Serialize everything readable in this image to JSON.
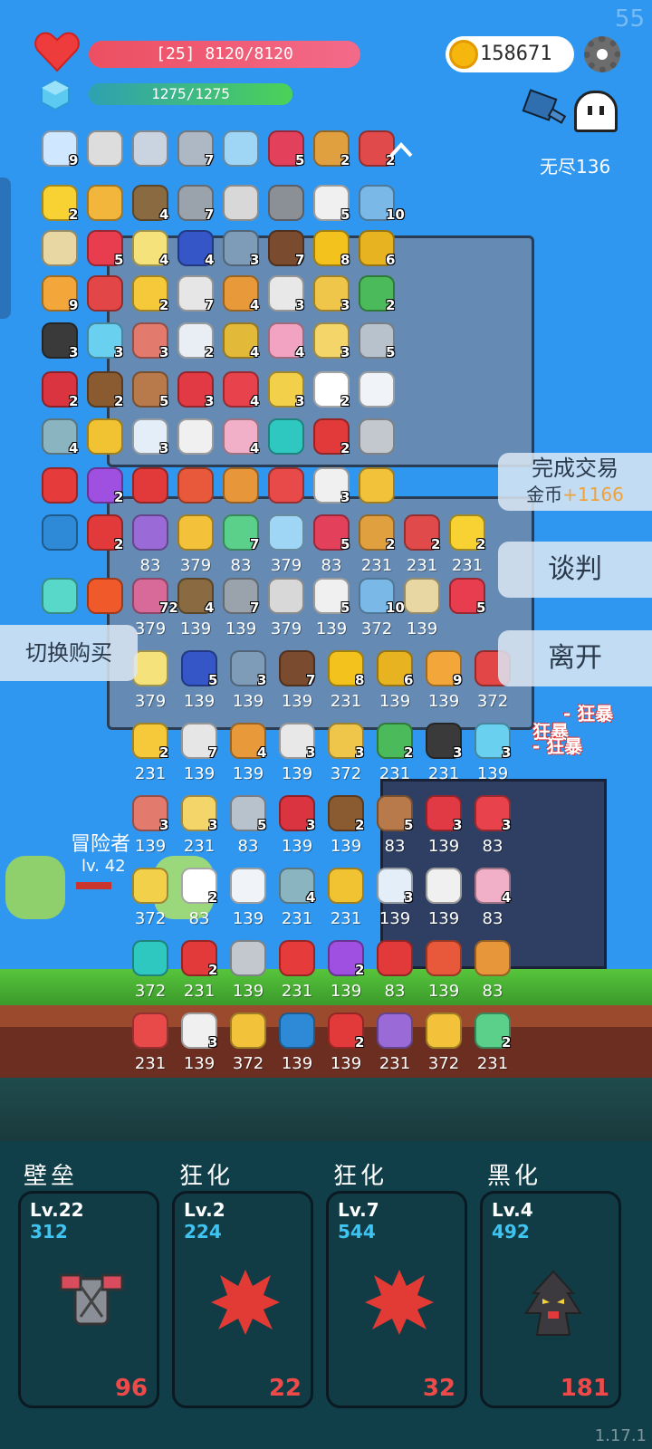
{
  "system": {
    "fps": "55",
    "version": "1.17.1"
  },
  "status": {
    "hp_text": "[25] 8120/8120",
    "hp_fraction": 1.0,
    "mp_text": "1275/1275",
    "mp_fraction": 1.0,
    "gold": "158671",
    "mode_label": "无尽136"
  },
  "colors": {
    "sky": "#2f97f0",
    "hp": "#ec4f61",
    "mp": "#4cd257",
    "gold_accent": "#f0a23a",
    "skill_count": "#ef4a4a",
    "skill_power": "#3fc4f2"
  },
  "item_rows": [
    [
      {
        "icon": "syringe-icon",
        "color": "#cfe8ff",
        "qty": "9"
      },
      {
        "icon": "hook-icon",
        "color": "#dddddd",
        "qty": ""
      },
      {
        "icon": "sword-icon",
        "color": "#c9d4e0",
        "qty": ""
      },
      {
        "icon": "dagger-icon",
        "color": "#aeb8c4",
        "qty": "7"
      },
      {
        "icon": "empty-slot-icon",
        "color": "#9fd6f5",
        "qty": ""
      },
      {
        "icon": "jam-jar-icon",
        "color": "#e3415b",
        "qty": "5"
      },
      {
        "icon": "bow-icon",
        "color": "#e0a040",
        "qty": "2"
      },
      {
        "icon": "badge-shield-icon",
        "color": "#e04a4a",
        "qty": "2"
      }
    ],
    [
      {
        "icon": "sun-orb-icon",
        "color": "#f8d232",
        "qty": "2"
      },
      {
        "icon": "scroll-map-icon",
        "color": "#f3b63c",
        "qty": ""
      },
      {
        "icon": "noose-icon",
        "color": "#8a6a40",
        "qty": "4"
      },
      {
        "icon": "morning-star-icon",
        "color": "#9aa3ac",
        "qty": "7"
      },
      {
        "icon": "book-icon",
        "color": "#d8d8d8",
        "qty": ""
      },
      {
        "icon": "viking-helmet-icon",
        "color": "#8b8f96",
        "qty": ""
      },
      {
        "icon": "dice-icon",
        "color": "#f0f0f0",
        "qty": "5"
      },
      {
        "icon": "shirt-icon",
        "color": "#7ab8e8",
        "qty": "10"
      }
    ],
    [
      {
        "icon": "treasure-map-icon",
        "color": "#e9d7a3",
        "qty": ""
      },
      {
        "icon": "heart-item-icon",
        "color": "#e83d4f",
        "qty": "5"
      },
      {
        "icon": "moon-icon",
        "color": "#f6e27a",
        "qty": "4"
      },
      {
        "icon": "target-icon",
        "color": "#3556c7",
        "qty": "4"
      },
      {
        "icon": "shield-icon",
        "color": "#7e9cb8",
        "qty": "3"
      },
      {
        "icon": "coconut-icon",
        "color": "#7a4b2e",
        "qty": "7"
      },
      {
        "icon": "sunflower-icon",
        "color": "#f4c21c",
        "qty": "8"
      },
      {
        "icon": "pineapple-icon",
        "color": "#e8b320",
        "qty": "6"
      }
    ],
    [
      {
        "icon": "parchment-icon",
        "color": "#f3a63a",
        "qty": "9"
      },
      {
        "icon": "coupon-icon",
        "color": "#e24646",
        "qty": ""
      },
      {
        "icon": "cheese-icon",
        "color": "#f5c93a",
        "qty": "2"
      },
      {
        "icon": "bubbles-icon",
        "color": "#e6e6e6",
        "qty": "7"
      },
      {
        "icon": "briefcase-icon",
        "color": "#e89a3a",
        "qty": "4"
      },
      {
        "icon": "pill-icon",
        "color": "#e8e8e8",
        "qty": "3"
      },
      {
        "icon": "ring-icon",
        "color": "#f0c64a",
        "qty": "3"
      },
      {
        "icon": "cash-icon",
        "color": "#4aba5a",
        "qty": "2"
      }
    ],
    [
      {
        "icon": "cauldron-icon",
        "color": "#3a3a3a",
        "qty": "3"
      },
      {
        "icon": "potion-flask-icon",
        "color": "#6ad0f0",
        "qty": "3"
      },
      {
        "icon": "steak-icon",
        "color": "#e27a6e",
        "qty": "3"
      },
      {
        "icon": "envelope-icon",
        "color": "#e8eef4",
        "qty": "2"
      },
      {
        "icon": "egg-icon",
        "color": "#e3b93a",
        "qty": "4"
      },
      {
        "icon": "perfume-icon",
        "color": "#f2a3c2",
        "qty": "4"
      },
      {
        "icon": "note-icon",
        "color": "#f3d56a",
        "qty": "3"
      },
      {
        "icon": "greatsword-icon",
        "color": "#b8c2cc",
        "qty": "5"
      }
    ],
    [
      {
        "icon": "red-potion-icon",
        "color": "#d9343f",
        "qty": "2"
      },
      {
        "icon": "chestnut-icon",
        "color": "#8a5a30",
        "qty": "2"
      },
      {
        "icon": "donut-icon",
        "color": "#b87a4a",
        "qty": "5"
      },
      {
        "icon": "strawberry-icon",
        "color": "#e23a45",
        "qty": "3"
      },
      {
        "icon": "watermelon-icon",
        "color": "#e8424c",
        "qty": "4"
      },
      {
        "icon": "halo-icon",
        "color": "#f3d04a",
        "qty": "3"
      },
      {
        "icon": "flower-icon",
        "color": "#ffffff",
        "qty": "2"
      },
      {
        "icon": "cloud-icon",
        "color": "#f0f4f8",
        "qty": ""
      }
    ],
    [
      {
        "icon": "round-shield-icon",
        "color": "#8ab4c0",
        "qty": "4"
      },
      {
        "icon": "battery-icon",
        "color": "#f1c232",
        "qty": ""
      },
      {
        "icon": "capsule-icon",
        "color": "#e4eef8",
        "qty": "3"
      },
      {
        "icon": "clipboard-icon",
        "color": "#f0f0f0",
        "qty": ""
      },
      {
        "icon": "ice-cream-icon",
        "color": "#f2b0c8",
        "qty": "4"
      },
      {
        "icon": "spiral-icon",
        "color": "#2ec8c0",
        "qty": ""
      },
      {
        "icon": "map-pin-icon",
        "color": "#e23a3a",
        "qty": "2"
      },
      {
        "icon": "battle-axe-icon",
        "color": "#c2c8ce",
        "qty": ""
      }
    ],
    [
      {
        "icon": "bookmark-icon",
        "color": "#e63b3b",
        "qty": ""
      },
      {
        "icon": "crystal-ball-icon",
        "color": "#a050e0",
        "qty": "2"
      },
      {
        "icon": "apple-icon",
        "color": "#e23a3a",
        "qty": ""
      },
      {
        "icon": "sock-icon",
        "color": "#e8583a",
        "qty": ""
      },
      {
        "icon": "tome-icon",
        "color": "#e8963a",
        "qty": ""
      },
      {
        "icon": "gift-icon",
        "color": "#e84a4a",
        "qty": ""
      },
      {
        "icon": "playing-card-icon",
        "color": "#f0f0f0",
        "qty": "3"
      },
      {
        "icon": "beer-icon",
        "color": "#f2c23a",
        "qty": ""
      }
    ],
    [
      {
        "icon": "speech-bubble-icon",
        "color": "#2e8ad6",
        "qty": ""
      },
      {
        "icon": "mushroom-icon",
        "color": "#e23a3a",
        "qty": "2"
      },
      {
        "icon": "star-shield-icon",
        "color": "#9a6ad6",
        "qty": ""
      },
      {
        "icon": "magic-wand-icon",
        "color": "#f3c23a",
        "qty": ""
      },
      {
        "icon": "gnome-icon",
        "color": "#5ad08a",
        "qty": "7"
      },
      {
        "icon": "empty-slot-icon",
        "color": "#9fd6f5",
        "qty": ""
      },
      {
        "icon": "jam-jar-icon",
        "color": "#e3415b",
        "qty": "5"
      },
      {
        "icon": "bow-icon",
        "color": "#e0a040",
        "qty": "2"
      },
      {
        "icon": "badge-shield-icon",
        "color": "#e04a4a",
        "qty": "2"
      },
      {
        "icon": "sun-orb-icon",
        "color": "#f8d232",
        "qty": "2"
      }
    ],
    [
      {
        "icon": "lightbulb-tile-icon",
        "color": "#57d8c8",
        "qty": ""
      },
      {
        "icon": "fire-tile-icon",
        "color": "#f05a2a",
        "qty": ""
      },
      {
        "icon": "stone-tile-icon",
        "color": "#d86a9a",
        "qty": "72"
      },
      {
        "icon": "noose-icon",
        "color": "#8a6a40",
        "qty": "4"
      },
      {
        "icon": "morning-star-icon",
        "color": "#9aa3ac",
        "qty": "7"
      },
      {
        "icon": "book-icon",
        "color": "#d8d8d8",
        "qty": ""
      },
      {
        "icon": "dice-icon",
        "color": "#f0f0f0",
        "qty": "5"
      },
      {
        "icon": "shirt-icon",
        "color": "#7ab8e8",
        "qty": "10"
      },
      {
        "icon": "treasure-map-icon",
        "color": "#e9d7a3",
        "qty": ""
      },
      {
        "icon": "heart-item-icon",
        "color": "#e83d4f",
        "qty": "5"
      }
    ]
  ],
  "shop_prices": {
    "row1": [
      "83",
      "379",
      "83",
      "379",
      "83",
      "231",
      "231",
      "231"
    ],
    "row2": [
      "379",
      "139",
      "139",
      "379",
      "139",
      "372",
      "139"
    ],
    "row3": [
      "379",
      "139",
      "139",
      "139",
      "231",
      "139",
      "139",
      "372"
    ],
    "row4": [
      "231",
      "139",
      "139",
      "139",
      "372",
      "231",
      "231",
      "139"
    ],
    "row5": [
      "139",
      "231",
      "83",
      "139",
      "139",
      "83",
      "139",
      "83"
    ],
    "row6": [
      "372",
      "83",
      "139",
      "231",
      "231",
      "139",
      "139",
      "83"
    ],
    "row7": [
      "372",
      "231",
      "139",
      "231",
      "139",
      "83",
      "139",
      "83"
    ],
    "row8": [
      "231",
      "139",
      "372",
      "139",
      "139",
      "231",
      "372",
      "231"
    ]
  },
  "shop_items": {
    "row3": [
      {
        "icon": "moon-icon",
        "color": "#f6e27a",
        "qty": ""
      },
      {
        "icon": "target-icon",
        "color": "#3556c7",
        "qty": "5"
      },
      {
        "icon": "shield-icon",
        "color": "#7e9cb8",
        "qty": "3"
      },
      {
        "icon": "coconut-icon",
        "color": "#7a4b2e",
        "qty": "7"
      },
      {
        "icon": "sunflower-icon",
        "color": "#f4c21c",
        "qty": "8"
      },
      {
        "icon": "pineapple-icon",
        "color": "#e8b320",
        "qty": "6"
      },
      {
        "icon": "parchment-icon",
        "color": "#f3a63a",
        "qty": "9"
      },
      {
        "icon": "coupon-icon",
        "color": "#e24646",
        "qty": ""
      }
    ],
    "row4": [
      {
        "icon": "cheese-icon",
        "color": "#f5c93a",
        "qty": "2"
      },
      {
        "icon": "bubbles-icon",
        "color": "#e6e6e6",
        "qty": "7"
      },
      {
        "icon": "briefcase-icon",
        "color": "#e89a3a",
        "qty": "4"
      },
      {
        "icon": "pill-icon",
        "color": "#e8e8e8",
        "qty": "3"
      },
      {
        "icon": "ring-icon",
        "color": "#f0c64a",
        "qty": "3"
      },
      {
        "icon": "cash-icon",
        "color": "#4aba5a",
        "qty": "2"
      },
      {
        "icon": "cauldron-icon",
        "color": "#3a3a3a",
        "qty": "3"
      },
      {
        "icon": "potion-flask-icon",
        "color": "#6ad0f0",
        "qty": "3"
      }
    ],
    "row5": [
      {
        "icon": "steak-icon",
        "color": "#e27a6e",
        "qty": "3"
      },
      {
        "icon": "note-icon",
        "color": "#f3d56a",
        "qty": "3"
      },
      {
        "icon": "greatsword-icon",
        "color": "#b8c2cc",
        "qty": "5"
      },
      {
        "icon": "red-potion-icon",
        "color": "#d9343f",
        "qty": "3"
      },
      {
        "icon": "chestnut-icon",
        "color": "#8a5a30",
        "qty": "2"
      },
      {
        "icon": "donut-icon",
        "color": "#b87a4a",
        "qty": "5"
      },
      {
        "icon": "strawberry-icon",
        "color": "#e23a45",
        "qty": "3"
      },
      {
        "icon": "watermelon-icon",
        "color": "#e8424c",
        "qty": "3"
      }
    ],
    "row6": [
      {
        "icon": "halo-icon",
        "color": "#f3d04a",
        "qty": ""
      },
      {
        "icon": "flower-icon",
        "color": "#ffffff",
        "qty": "2"
      },
      {
        "icon": "cloud-icon",
        "color": "#f0f4f8",
        "qty": ""
      },
      {
        "icon": "round-shield-icon",
        "color": "#8ab4c0",
        "qty": "4"
      },
      {
        "icon": "battery-icon",
        "color": "#f1c232",
        "qty": ""
      },
      {
        "icon": "capsule-icon",
        "color": "#e4eef8",
        "qty": "3"
      },
      {
        "icon": "clipboard-icon",
        "color": "#f0f0f0",
        "qty": ""
      },
      {
        "icon": "ice-cream-icon",
        "color": "#f2b0c8",
        "qty": "4"
      }
    ],
    "row7": [
      {
        "icon": "spiral-icon",
        "color": "#2ec8c0",
        "qty": ""
      },
      {
        "icon": "map-pin-icon",
        "color": "#e23a3a",
        "qty": "2"
      },
      {
        "icon": "battle-axe-icon",
        "color": "#c2c8ce",
        "qty": ""
      },
      {
        "icon": "bookmark-icon",
        "color": "#e63b3b",
        "qty": ""
      },
      {
        "icon": "crystal-ball-icon",
        "color": "#a050e0",
        "qty": "2"
      },
      {
        "icon": "apple-icon",
        "color": "#e23a3a",
        "qty": ""
      },
      {
        "icon": "sock-icon",
        "color": "#e8583a",
        "qty": ""
      },
      {
        "icon": "tome-icon",
        "color": "#e8963a",
        "qty": ""
      }
    ],
    "row8": [
      {
        "icon": "gift-icon",
        "color": "#e84a4a",
        "qty": ""
      },
      {
        "icon": "playing-card-icon",
        "color": "#f0f0f0",
        "qty": "3"
      },
      {
        "icon": "beer-icon",
        "color": "#f2c23a",
        "qty": ""
      },
      {
        "icon": "speech-bubble-icon",
        "color": "#2e8ad6",
        "qty": ""
      },
      {
        "icon": "mushroom-icon",
        "color": "#e23a3a",
        "qty": "2"
      },
      {
        "icon": "star-shield-icon",
        "color": "#9a6ad6",
        "qty": ""
      },
      {
        "icon": "magic-wand-icon",
        "color": "#f3c23a",
        "qty": ""
      },
      {
        "icon": "gnome-icon",
        "color": "#5ad08a",
        "qty": "2"
      }
    ]
  },
  "trade": {
    "complete_label": "完成交易",
    "gold_prefix": "金币",
    "gold_amount": "+1166",
    "negotiate_label": "谈判",
    "leave_label": "离开",
    "switch_label": "切换购买"
  },
  "battle": {
    "hero_name": "冒险者",
    "hero_level": "lv. 42",
    "hero_hp_fraction": 0.7,
    "rage_1": "- 狂暴",
    "rage_2": "狂暴",
    "rage_3": "- 狂暴"
  },
  "skills": [
    {
      "title": "壁垒",
      "level": "Lv.22",
      "power": "312",
      "count": "96",
      "icon": "armor-icon"
    },
    {
      "title": "狂化",
      "level": "Lv.2",
      "power": "224",
      "count": "22",
      "icon": "rage-splat-icon"
    },
    {
      "title": "狂化",
      "level": "Lv.7",
      "power": "544",
      "count": "32",
      "icon": "rage-splat-icon"
    },
    {
      "title": "黑化",
      "level": "Lv.4",
      "power": "492",
      "count": "181",
      "icon": "dark-tree-icon"
    }
  ]
}
